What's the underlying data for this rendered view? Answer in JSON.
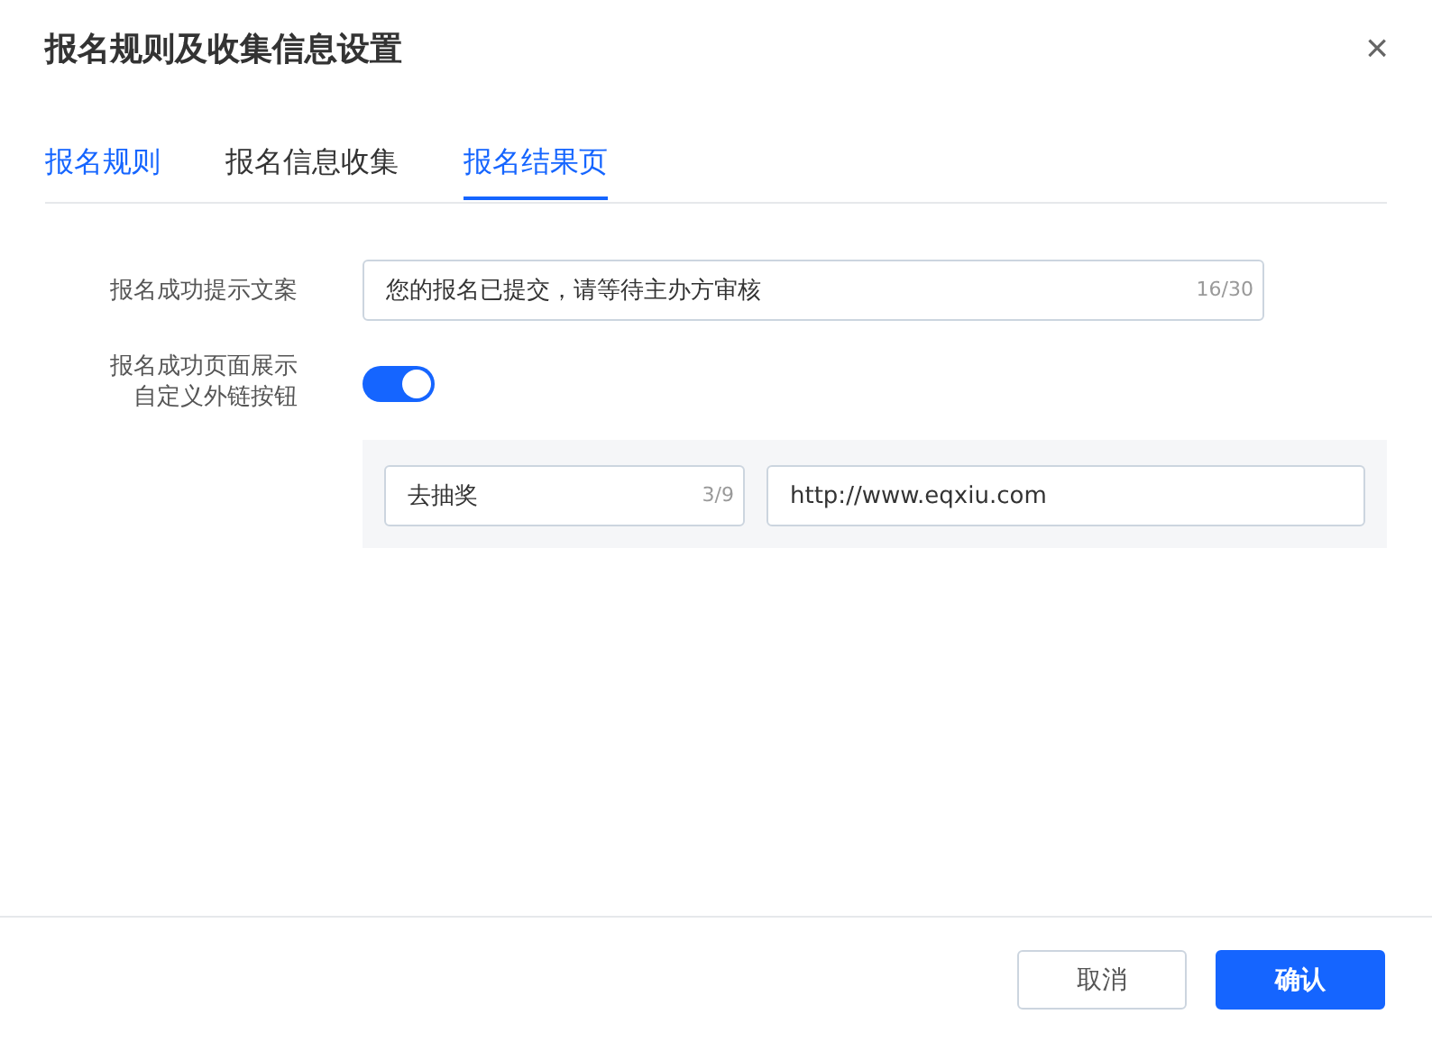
{
  "dialog": {
    "title": "报名规则及收集信息设置",
    "close_icon": "×"
  },
  "tabs": [
    {
      "label": "报名规则",
      "selected": false,
      "hovered": true
    },
    {
      "label": "报名信息收集",
      "selected": false,
      "hovered": false
    },
    {
      "label": "报名结果页",
      "selected": true,
      "hovered": false
    }
  ],
  "form": {
    "success_message": {
      "label": "报名成功提示文案",
      "value": "您的报名已提交，请等待主办方审核",
      "count": "16/30"
    },
    "custom_link": {
      "label_lines": [
        "报名成功页面展示",
        "自定义外链按钮"
      ],
      "on": true,
      "button_text": {
        "value": "去抽奖",
        "count": "3/9"
      },
      "url": {
        "value": "http://www.eqxiu.com"
      }
    }
  },
  "buttons": [
    {
      "label": "取消",
      "kind": "secondary"
    },
    {
      "label": "确认",
      "kind": "primary"
    }
  ]
}
